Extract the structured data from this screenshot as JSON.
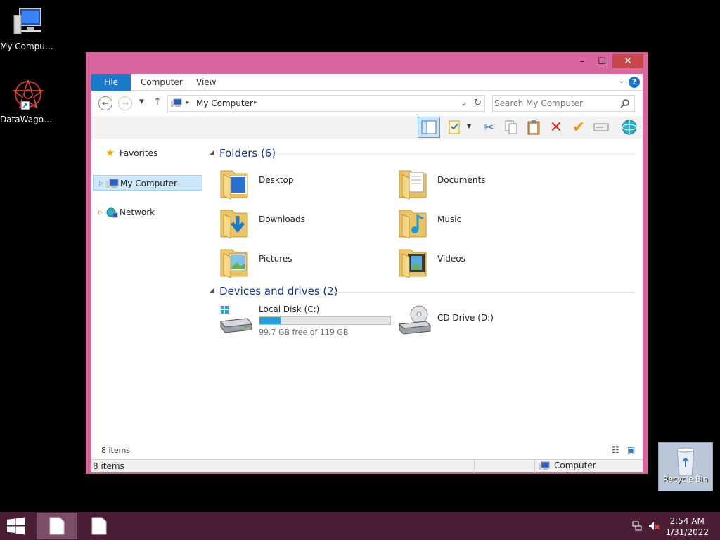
{
  "desktop": {
    "icons": [
      {
        "label": "My Computer"
      },
      {
        "label": "DataWagon..."
      }
    ],
    "recycle_bin": {
      "label": "Recycle Bin"
    }
  },
  "window": {
    "buttons": {
      "minimize": "–",
      "maximize": "☐",
      "close": "✕"
    },
    "ribbon": {
      "tabs": [
        "File",
        "Computer",
        "View"
      ],
      "help": "?"
    },
    "address": {
      "path": "My Computer"
    },
    "search": {
      "placeholder": "Search My Computer"
    },
    "nav": {
      "favorites": "Favorites",
      "my_computer": "My Computer",
      "network": "Network"
    },
    "folders": {
      "header": "Folders (6)",
      "items": [
        "Desktop",
        "Documents",
        "Downloads",
        "Music",
        "Pictures",
        "Videos"
      ]
    },
    "drives": {
      "header": "Devices and drives (2)",
      "local": {
        "name": "Local Disk (C:)",
        "free_text": "99.7 GB free of 119 GB",
        "used_fraction": 0.162
      },
      "cd": {
        "name": "CD Drive (D:)"
      }
    },
    "item_count": "8 items",
    "status": {
      "count": "8 items",
      "location": "Computer"
    }
  },
  "taskbar": {
    "clock": {
      "time": "2:54 AM",
      "date": "1/31/2022"
    }
  },
  "colors": {
    "window_border": "#d8679f",
    "accent": "#1979ca",
    "taskbar": "#4b1e36"
  }
}
